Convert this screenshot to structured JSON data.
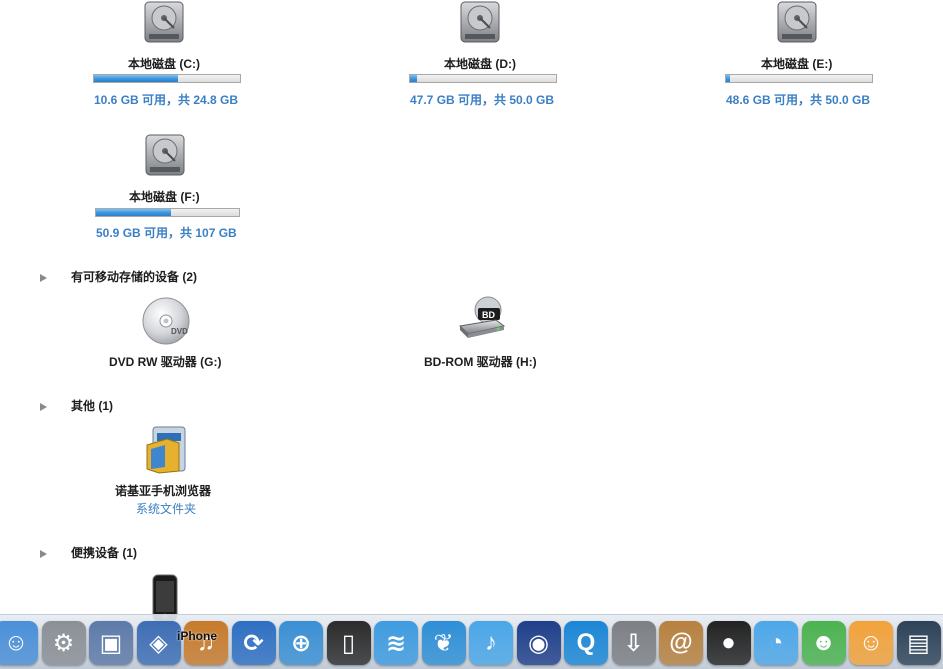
{
  "drives": [
    {
      "label": "本地磁盘 (C:)",
      "free_text": "10.6 GB 可用，共 24.8 GB",
      "used_fraction": 0.573
    },
    {
      "label": "本地磁盘 (D:)",
      "free_text": "47.7 GB 可用，共 50.0 GB",
      "used_fraction": 0.046
    },
    {
      "label": "本地磁盘 (E:)",
      "free_text": "48.6 GB 可用，共 50.0 GB",
      "used_fraction": 0.028
    },
    {
      "label": "本地磁盘 (F:)",
      "free_text": "50.9 GB 可用，共 107 GB",
      "used_fraction": 0.524
    }
  ],
  "removable_section": {
    "title": "有可移动存储的设备 (2)",
    "devices": [
      {
        "label": "DVD RW 驱动器 (G:)",
        "icon": "dvd-icon"
      },
      {
        "label": "BD-ROM 驱动器 (H:)",
        "icon": "bd-drive-icon",
        "badge": "BD"
      }
    ]
  },
  "other_section": {
    "title": "其他 (1)",
    "items": [
      {
        "label": "诺基亚手机浏览器",
        "sublabel": "系统文件夹",
        "icon": "nokia-folder-icon"
      }
    ]
  },
  "portable_section": {
    "title": "便携设备 (1)",
    "items": [
      {
        "label": "iPhone",
        "icon": "iphone-icon"
      }
    ]
  },
  "dock": {
    "items": [
      {
        "name": "finder-icon",
        "color": "#4a8fd8"
      },
      {
        "name": "system-preferences-icon",
        "color": "#8b8f96"
      },
      {
        "name": "photo-icon",
        "color": "#5d7aa8"
      },
      {
        "name": "preview-icon",
        "color": "#3d6db4"
      },
      {
        "name": "garageband-icon",
        "color": "#c77a2a"
      },
      {
        "name": "sync-icon",
        "color": "#2e6fc2"
      },
      {
        "name": "safari-icon",
        "color": "#3a8fd4"
      },
      {
        "name": "iphone-app-icon",
        "color": "#2b2b2b"
      },
      {
        "name": "wifi-icon",
        "color": "#3d9be0"
      },
      {
        "name": "feather-icon",
        "color": "#2e8fd6"
      },
      {
        "name": "itunes-icon",
        "color": "#4aa6e8"
      },
      {
        "name": "media-icon",
        "color": "#1f3f8a"
      },
      {
        "name": "quicktime-icon",
        "color": "#1a86d6"
      },
      {
        "name": "download-icon",
        "color": "#7c7f84"
      },
      {
        "name": "address-book-icon",
        "color": "#b7813f"
      },
      {
        "name": "qq-icon",
        "color": "#222222"
      },
      {
        "name": "chat-bubble-icon",
        "color": "#4ca7e8"
      },
      {
        "name": "messenger-icon",
        "color": "#4bb34f"
      },
      {
        "name": "emoji-icon",
        "color": "#f2a23a"
      },
      {
        "name": "terminal-icon",
        "color": "#2d4258"
      }
    ],
    "overlay_label": "iPhone"
  }
}
